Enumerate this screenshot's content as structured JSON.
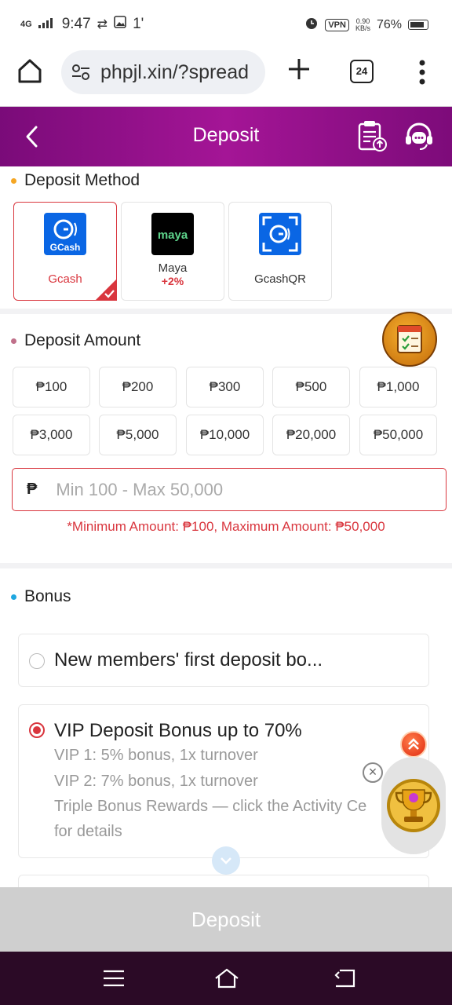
{
  "status_bar": {
    "network": "4G",
    "time": "9:47",
    "extra": "1'",
    "vpn": "VPN",
    "speed_top": "0.90",
    "speed_bottom": "KB/s",
    "battery": "76%"
  },
  "browser": {
    "url": "phpjl.xin/?spread",
    "tab_count": "24"
  },
  "header": {
    "title": "Deposit"
  },
  "deposit_method": {
    "title": "Deposit Method",
    "methods": [
      {
        "name": "Gcash",
        "logo_text": "GCash",
        "extra": "",
        "selected": true
      },
      {
        "name": "Maya",
        "logo_text": "maya",
        "extra": "+2%",
        "selected": false
      },
      {
        "name": "GcashQR",
        "logo_text": "",
        "extra": "",
        "selected": false
      }
    ]
  },
  "deposit_amount": {
    "title": "Deposit Amount",
    "amounts": [
      "₱100",
      "₱200",
      "₱300",
      "₱500",
      "₱1,000",
      "₱3,000",
      "₱5,000",
      "₱10,000",
      "₱20,000",
      "₱50,000"
    ],
    "currency": "₱",
    "placeholder": "Min 100 - Max 50,000",
    "limit_note": "*Minimum Amount: ₱100, Maximum Amount: ₱50,000"
  },
  "bonus": {
    "title": "Bonus",
    "options": [
      {
        "title": "New members' first deposit bo...",
        "selected": false,
        "lines": []
      },
      {
        "title": "VIP Deposit Bonus up to 70%",
        "selected": true,
        "lines": [
          "VIP 1: 5% bonus, 1x turnover",
          "VIP 2: 7% bonus, 1x turnover",
          "Triple Bonus Rewards — click the Activity Ce",
          "for details"
        ]
      }
    ]
  },
  "footer": {
    "deposit_label": "Deposit"
  },
  "colors": {
    "brand": "#a41596",
    "accent": "#d9363e",
    "gcash_blue": "#0a66e4"
  }
}
